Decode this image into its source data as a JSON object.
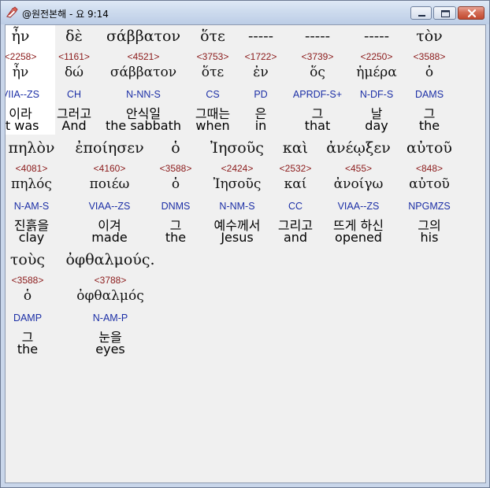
{
  "window": {
    "title": "@원전본해 - 요 9:14"
  },
  "icons": {
    "app": "bible-app-icon",
    "minimize": "minimize-icon",
    "maximize": "maximize-icon",
    "close": "close-icon"
  },
  "colors": {
    "strong": "#8b1a1a",
    "morph": "#1c2fa6",
    "highlight": "#ffffff"
  },
  "verse": {
    "lines": [
      {
        "words": [
          {
            "greek": "ἦν",
            "strong": "<2258>",
            "lemma": "ἦν",
            "morph": "VIIA--ZS",
            "korean": "이라",
            "english": "it was",
            "highlighted": true
          },
          {
            "greek": "δὲ",
            "strong": "<1161>",
            "lemma": "δώ",
            "morph": "CH",
            "korean": "그러고",
            "english": "And"
          },
          {
            "greek": "σάββατον",
            "strong": "<4521>",
            "lemma": "σάββατον",
            "morph": "N-NN-S",
            "korean": "안식일",
            "english": "the sabbath"
          },
          {
            "greek": "ὅτε",
            "strong": "<3753>",
            "lemma": "ὅτε",
            "morph": "CS",
            "korean": "그때는",
            "english": "when"
          },
          {
            "greek": "-----",
            "strong": "<1722>",
            "lemma": "ἐν",
            "morph": "PD",
            "korean": "은",
            "english": "in"
          },
          {
            "greek": "-----",
            "strong": "<3739>",
            "lemma": "ὅς",
            "morph": "APRDF-S+",
            "korean": "그",
            "english": "that"
          },
          {
            "greek": "-----",
            "strong": "<2250>",
            "lemma": "ἡμέρα",
            "morph": "N-DF-S",
            "korean": "날",
            "english": "day"
          },
          {
            "greek": "τὸν",
            "strong": "<3588>",
            "lemma": "ὁ",
            "morph": "DAMS",
            "korean": "그",
            "english": "the"
          }
        ]
      },
      {
        "words": [
          {
            "greek": "πηλὸν",
            "strong": "<4081>",
            "lemma": "πηλός",
            "morph": "N-AM-S",
            "korean": "진흙을",
            "english": "clay"
          },
          {
            "greek": "ἐποίησεν",
            "strong": "<4160>",
            "lemma": "ποιέω",
            "morph": "VIAA--ZS",
            "korean": "이겨",
            "english": "made"
          },
          {
            "greek": "ὁ",
            "strong": "<3588>",
            "lemma": "ὁ",
            "morph": "DNMS",
            "korean": "그",
            "english": "the"
          },
          {
            "greek": "Ἰησοῦς",
            "strong": "<2424>",
            "lemma": "Ἰησοῦς",
            "morph": "N-NM-S",
            "korean": "예수께서",
            "english": "Jesus"
          },
          {
            "greek": "καὶ",
            "strong": "<2532>",
            "lemma": "καί",
            "morph": "CC",
            "korean": "그리고",
            "english": "and"
          },
          {
            "greek": "ἀνέῳξεν",
            "strong": "<455>",
            "lemma": "ἀνοίγω",
            "morph": "VIAA--ZS",
            "korean": "뜨게 하신",
            "english": "opened"
          },
          {
            "greek": "αὐτοῦ",
            "strong": "<848>",
            "lemma": "αὐτοῦ",
            "morph": "NPGMZS",
            "korean": "그의",
            "english": "his"
          }
        ]
      },
      {
        "words": [
          {
            "greek": "τοὺς",
            "strong": "<3588>",
            "lemma": "ὁ",
            "morph": "DAMP",
            "korean": "그",
            "english": "the"
          },
          {
            "greek": "ὀφθαλμούς.",
            "strong": "<3788>",
            "lemma": "ὀφθαλμός",
            "morph": "N-AM-P",
            "korean": "눈을",
            "english": "eyes"
          }
        ]
      }
    ]
  }
}
